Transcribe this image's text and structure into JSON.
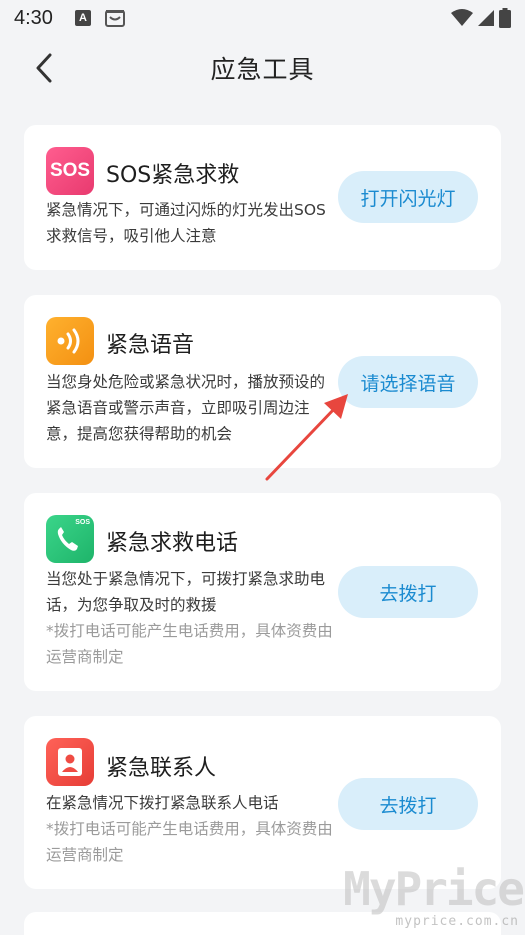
{
  "status_bar": {
    "time": "4:30",
    "notification_icons": [
      "a-notification-icon",
      "smile-box-icon"
    ],
    "right_icons": [
      "wifi-icon",
      "signal-icon",
      "battery-icon"
    ]
  },
  "header": {
    "title": "应急工具",
    "back_icon": "chevron-left-icon"
  },
  "cards": [
    {
      "icon": "sos-icon",
      "icon_text": "SOS",
      "icon_color": "#f0457a",
      "title": "SOS紧急求救",
      "description": "紧急情况下，可通过闪烁的灯光发出SOS求救信号，吸引他人注意",
      "button": "打开闪光灯"
    },
    {
      "icon": "voice-waves-icon",
      "icon_color": "#f9a01b",
      "title": "紧急语音",
      "description": "当您身处危险或紧急状况时，播放预设的紧急语音或警示声音，立即吸引周边注意，提高您获得帮助的机会",
      "button": "请选择语音"
    },
    {
      "icon": "phone-sos-icon",
      "icon_text": "SOS",
      "icon_color": "#2ac47a",
      "title": "紧急求救电话",
      "description": "当您处于紧急情况下，可拨打紧急求助电话，为您争取及时的救援",
      "note": "*拨打电话可能产生电话费用，具体资费由运营商制定",
      "button": "去拨打"
    },
    {
      "icon": "contact-card-icon",
      "icon_color": "#ef4b43",
      "title": "紧急联系人",
      "description": "在紧急情况下拨打紧急联系人电话",
      "note": "*拨打电话可能产生电话费用，具体资费由运营商制定",
      "button": "去拨打"
    }
  ],
  "watermark": {
    "main": "MyPrice",
    "sub": "myprice.com.cn"
  },
  "colors": {
    "background": "#f3f4f6",
    "card": "#ffffff",
    "button_bg": "#d9eefa",
    "button_text": "#1b8bd0",
    "arrow": "#e8463e"
  }
}
